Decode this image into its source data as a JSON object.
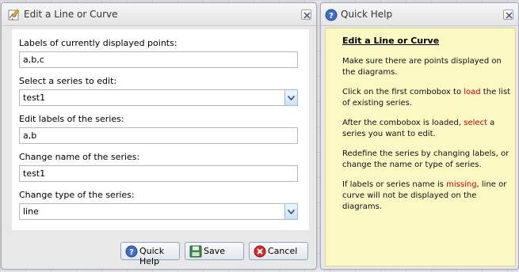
{
  "edit_dialog": {
    "title": "Edit a Line or Curve",
    "fields": {
      "labels_current_label": "Labels of currently displayed points:",
      "labels_current_value": "a,b,c",
      "select_series_label": "Select a series to edit:",
      "select_series_value": "test1",
      "edit_labels_label": "Edit labels of the series:",
      "edit_labels_value": "a,b",
      "change_name_label": "Change name of the series:",
      "change_name_value": "test1",
      "change_type_label": "Change type of the series:",
      "change_type_value": "line"
    },
    "buttons": {
      "quick_help": "Quick Help",
      "save": "Save",
      "cancel": "Cancel"
    }
  },
  "help_dialog": {
    "title": "Quick Help",
    "heading": "Edit a Line or Curve",
    "p1": "Make sure there are points displayed on the diagrams.",
    "p2_a": "Click on the first combobox to ",
    "p2_hl": "load",
    "p2_b": " the list of existing series.",
    "p3_a": "After the combobox is loaded, ",
    "p3_hl": "select",
    "p3_b": " a series you want to edit.",
    "p4": "Redefine the series by changing labels, or change the name or type of series.",
    "p5_a": "If labels or series name is ",
    "p5_hl": "missing",
    "p5_b": ", line or curve will not be displayed on the diagrams."
  },
  "colors": {
    "highlight": "#cc0000",
    "help_background": "#fbf8c4"
  },
  "icons": {
    "edit_title": "pencil-chart-icon",
    "help_title": "help-icon",
    "quick_help_button": "help-icon",
    "save_button": "save-icon",
    "cancel_button": "cancel-icon",
    "close": "close-icon",
    "combo": "chevron-down-icon"
  }
}
